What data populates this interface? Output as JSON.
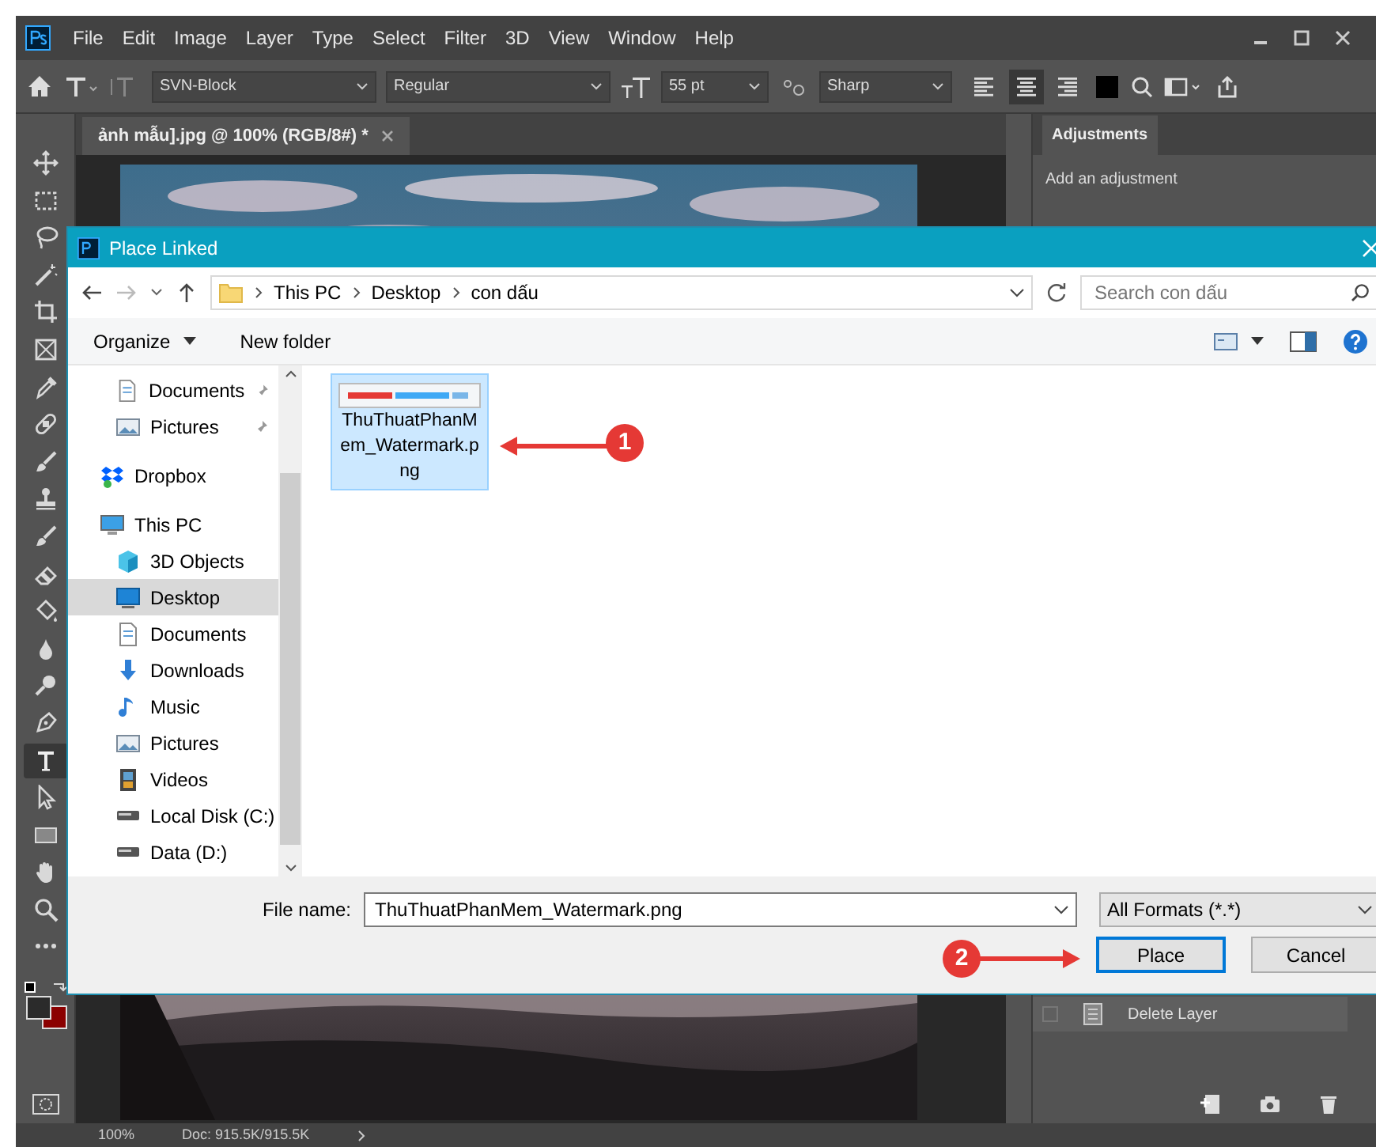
{
  "menu": [
    "File",
    "Edit",
    "Image",
    "Layer",
    "Type",
    "Select",
    "Filter",
    "3D",
    "View",
    "Window",
    "Help"
  ],
  "options": {
    "font_family": "SVN-Block",
    "font_style": "Regular",
    "font_size": "55 pt",
    "antialiasing": "Sharp",
    "align": [
      {
        "kind": "left",
        "selected": false
      },
      {
        "kind": "center",
        "selected": true
      },
      {
        "kind": "right",
        "selected": false
      }
    ]
  },
  "document_tab": {
    "title": "ảnh mẫu].jpg @ 100% (RGB/8#) *"
  },
  "tools": [
    {
      "kind": "move",
      "selected": false
    },
    {
      "kind": "marquee",
      "selected": false
    },
    {
      "kind": "lasso",
      "selected": false
    },
    {
      "kind": "wand",
      "selected": false
    },
    {
      "kind": "crop",
      "selected": false
    },
    {
      "kind": "frame",
      "selected": false
    },
    {
      "kind": "eyedropper",
      "selected": false
    },
    {
      "kind": "bandage",
      "selected": false
    },
    {
      "kind": "brush",
      "selected": false
    },
    {
      "kind": "stamp",
      "selected": false
    },
    {
      "kind": "brush",
      "selected": false
    },
    {
      "kind": "eraser",
      "selected": false
    },
    {
      "kind": "bucket",
      "selected": false
    },
    {
      "kind": "drop",
      "selected": false
    },
    {
      "kind": "dodge",
      "selected": false
    },
    {
      "kind": "pen",
      "selected": false
    },
    {
      "kind": "type",
      "selected": true
    },
    {
      "kind": "pointer",
      "selected": false
    },
    {
      "kind": "rectangle",
      "selected": false
    },
    {
      "kind": "hand",
      "selected": false
    },
    {
      "kind": "zoom",
      "selected": false
    },
    {
      "kind": "more",
      "selected": false
    }
  ],
  "panel": {
    "tab": "Adjustments",
    "hint": "Add an adjustment",
    "history": [
      {
        "label": "Delete Layer"
      }
    ]
  },
  "status_bar": {
    "zoom": "100%",
    "doc": "Doc: 915.5K/915.5K"
  },
  "dialog": {
    "title": "Place Linked",
    "breadcrumb": [
      "This PC",
      "Desktop",
      "con dấu"
    ],
    "search": {
      "placeholder": "Search con dấu"
    },
    "commands": [
      {
        "label": "Organize",
        "kind": "menu"
      },
      {
        "label": "New folder",
        "kind": "plain"
      }
    ],
    "nav": {
      "quick_access": [
        {
          "label": "Documents",
          "kind": "document",
          "pinned": true,
          "selected": false
        },
        {
          "label": "Pictures",
          "kind": "pictures",
          "pinned": true,
          "selected": false
        }
      ],
      "items": [
        {
          "label": "Dropbox",
          "kind": "dropbox",
          "selected": false
        },
        {
          "label": "This PC",
          "kind": "pc",
          "selected": false,
          "children": [
            {
              "label": "3D Objects",
              "kind": "cube",
              "selected": false
            },
            {
              "label": "Desktop",
              "kind": "desktop",
              "selected": true
            },
            {
              "label": "Documents",
              "kind": "document",
              "selected": false
            },
            {
              "label": "Downloads",
              "kind": "download",
              "selected": false
            },
            {
              "label": "Music",
              "kind": "music",
              "selected": false
            },
            {
              "label": "Pictures",
              "kind": "pictures",
              "selected": false
            },
            {
              "label": "Videos",
              "kind": "video",
              "selected": false
            },
            {
              "label": "Local Disk (C:)",
              "kind": "drive",
              "selected": false
            },
            {
              "label": "Data (D:)",
              "kind": "drive",
              "selected": false
            }
          ]
        }
      ]
    },
    "files": [
      {
        "name": "ThuThuatPhanMem_Watermark.png",
        "selected": true
      }
    ],
    "file_name_label": "File name:",
    "file_name": "ThuThuatPhanMem_Watermark.png",
    "filter": "All Formats (*.*)",
    "buttons": [
      {
        "label": "Place",
        "default": true
      },
      {
        "label": "Cancel",
        "default": false
      }
    ]
  },
  "annotations": [
    {
      "label": "1"
    },
    {
      "label": "2"
    }
  ]
}
